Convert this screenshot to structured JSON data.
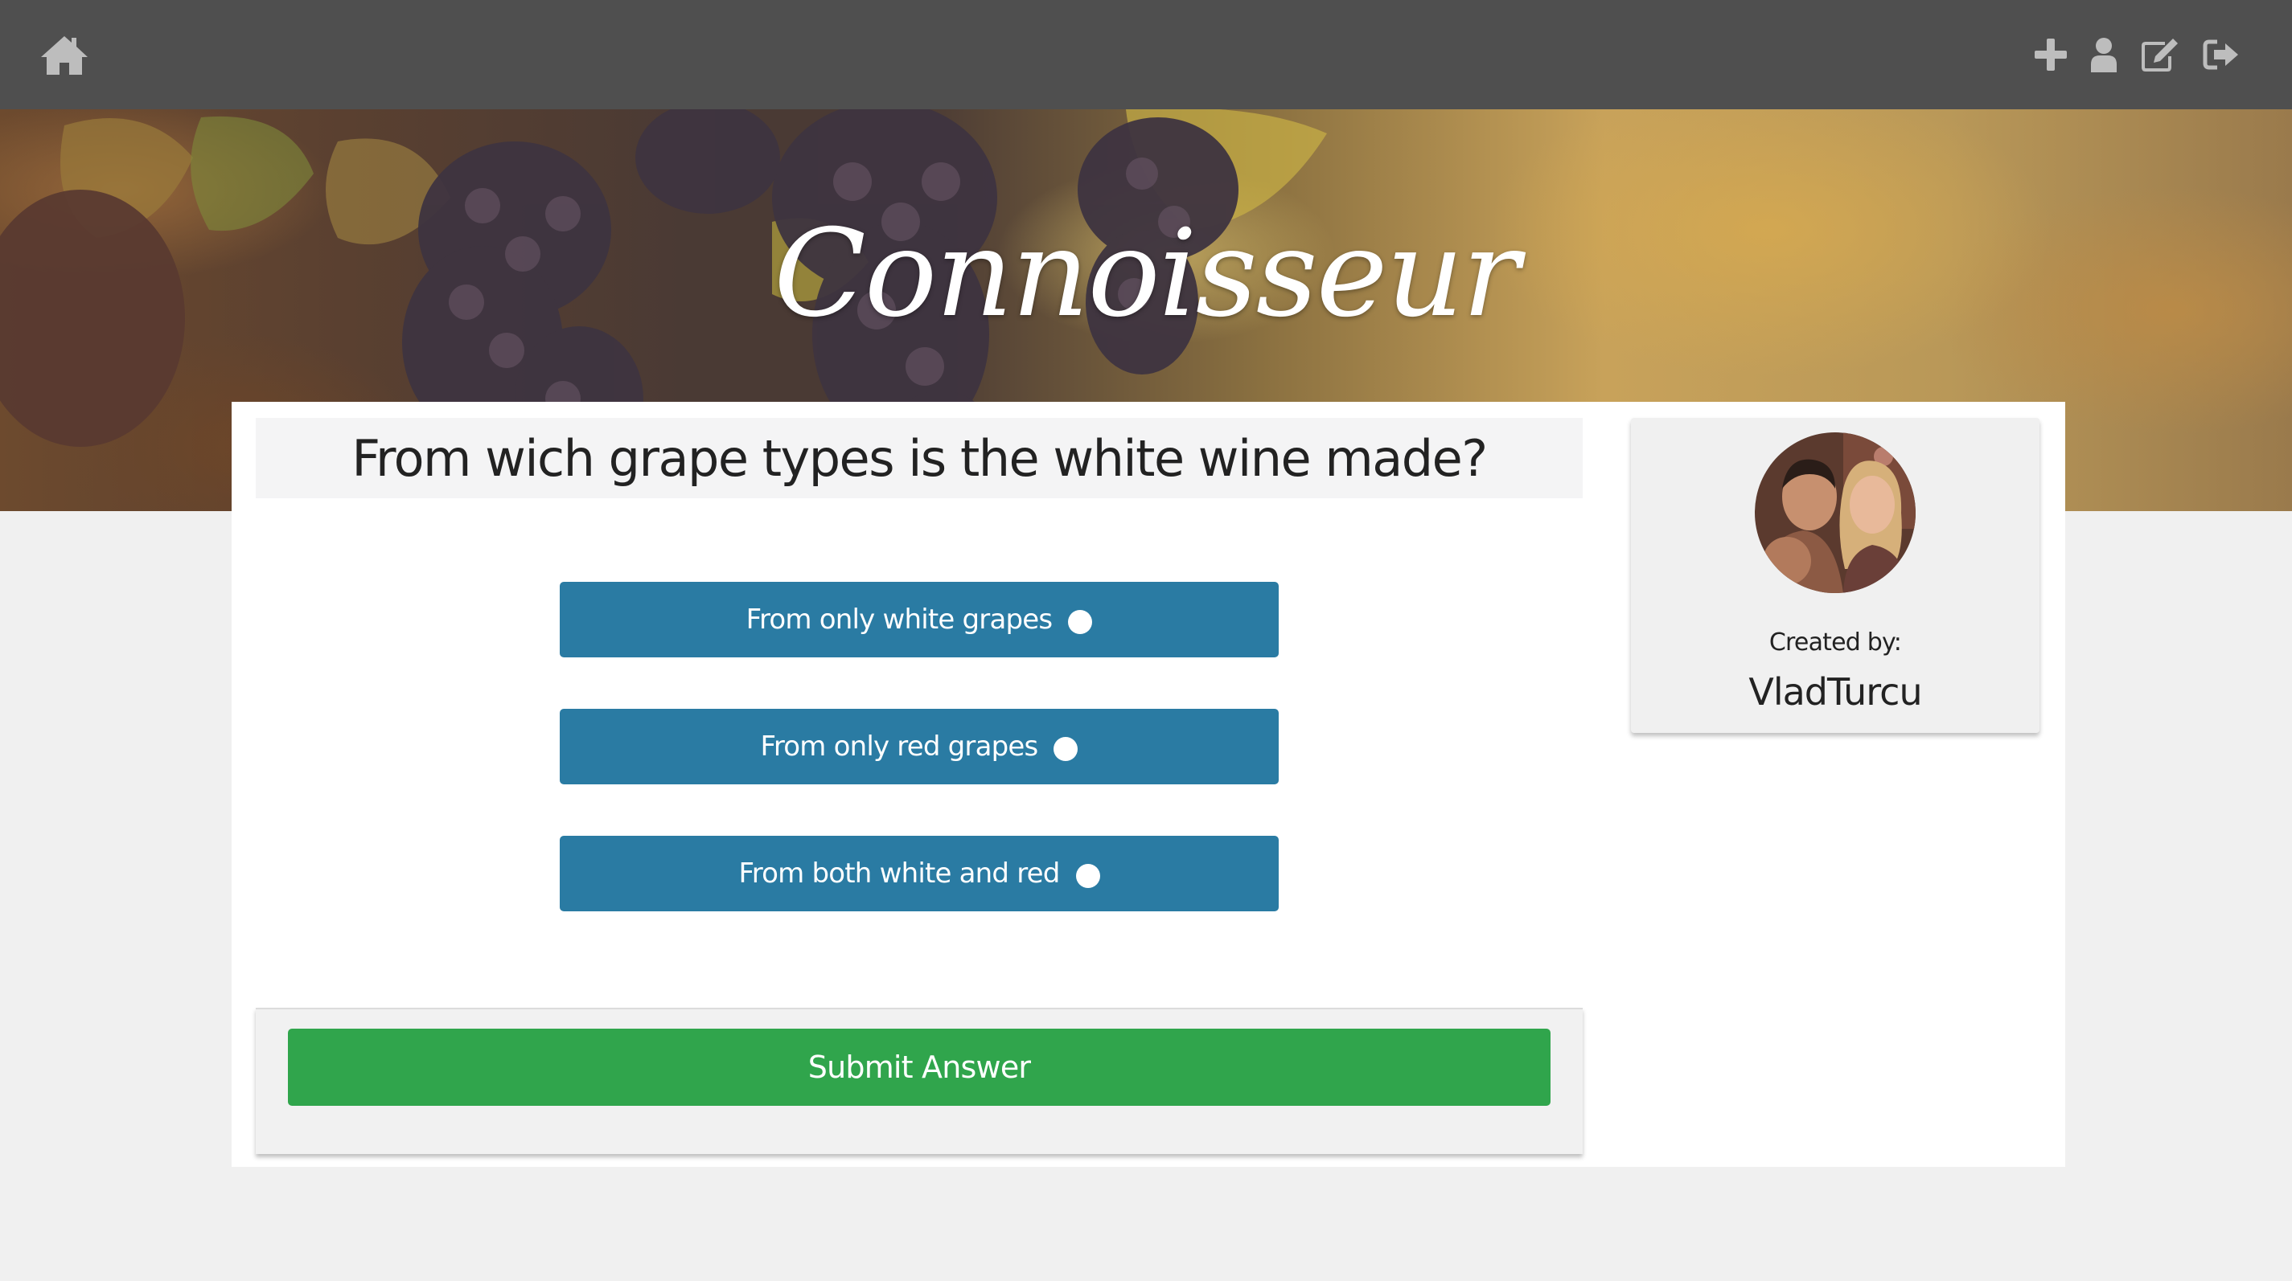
{
  "navbar": {
    "icons": {
      "home": "home-icon",
      "add": "plus-icon",
      "profile": "user-icon",
      "edit": "edit-icon",
      "logout": "sign-out-icon"
    },
    "icon_color": "#bdbdbd",
    "background": "#4f4f4f"
  },
  "hero": {
    "title": "Connoisseur"
  },
  "quiz": {
    "question": "From wich grape types is the white wine made?",
    "answers": [
      {
        "label": "From only white grapes"
      },
      {
        "label": "From only red grapes"
      },
      {
        "label": "From both white and red"
      }
    ],
    "submit_label": "Submit Answer",
    "answer_color": "#2a7ba3",
    "submit_color": "#30a54c"
  },
  "author": {
    "created_by_label": "Created by:",
    "name": "VladTurcu",
    "avatar_icon": "avatar-photo"
  }
}
